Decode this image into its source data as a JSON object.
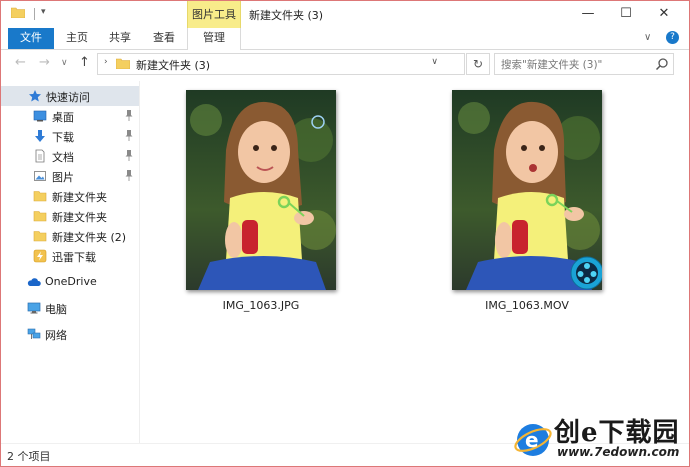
{
  "titlebar": {
    "context_tab": "图片工具",
    "title": "新建文件夹 (3)",
    "minimize": "—",
    "maximize": "☐",
    "close": "✕"
  },
  "ribbon": {
    "tabs": [
      "文件",
      "主页",
      "共享",
      "查看",
      "管理"
    ],
    "expand": "∨",
    "help": "?"
  },
  "address": {
    "back": "←",
    "forward": "→",
    "recent": "∨",
    "up": "↑",
    "chevron": "›",
    "path": "新建文件夹 (3)",
    "dropdown": "∨",
    "refresh": "↻"
  },
  "search": {
    "placeholder": "搜索\"新建文件夹 (3)\""
  },
  "sidebar": {
    "items": [
      {
        "label": "快速访问",
        "icon": "star-icon"
      },
      {
        "label": "桌面",
        "icon": "desktop-icon",
        "pinned": true
      },
      {
        "label": "下载",
        "icon": "download-icon",
        "pinned": true
      },
      {
        "label": "文档",
        "icon": "document-icon",
        "pinned": true
      },
      {
        "label": "图片",
        "icon": "pictures-icon",
        "pinned": true
      },
      {
        "label": "新建文件夹",
        "icon": "folder-icon"
      },
      {
        "label": "新建文件夹",
        "icon": "folder-icon"
      },
      {
        "label": "新建文件夹 (2)",
        "icon": "folder-icon"
      },
      {
        "label": "迅雷下载",
        "icon": "thunder-icon"
      },
      {
        "label": "OneDrive",
        "icon": "cloud-icon"
      },
      {
        "label": "电脑",
        "icon": "computer-icon"
      },
      {
        "label": "网络",
        "icon": "network-icon"
      }
    ]
  },
  "files": [
    {
      "name": "IMG_1063.JPG",
      "type": "image"
    },
    {
      "name": "IMG_1063.MOV",
      "type": "video"
    }
  ],
  "status": {
    "count": "2 个项目"
  },
  "watermark": {
    "brand": "创e下载园",
    "url": "www.7edown.com"
  },
  "colors": {
    "file_tab": "#1979ca",
    "context_tab": "#f8ec8a",
    "selected_nav": "#dfe5ec"
  }
}
